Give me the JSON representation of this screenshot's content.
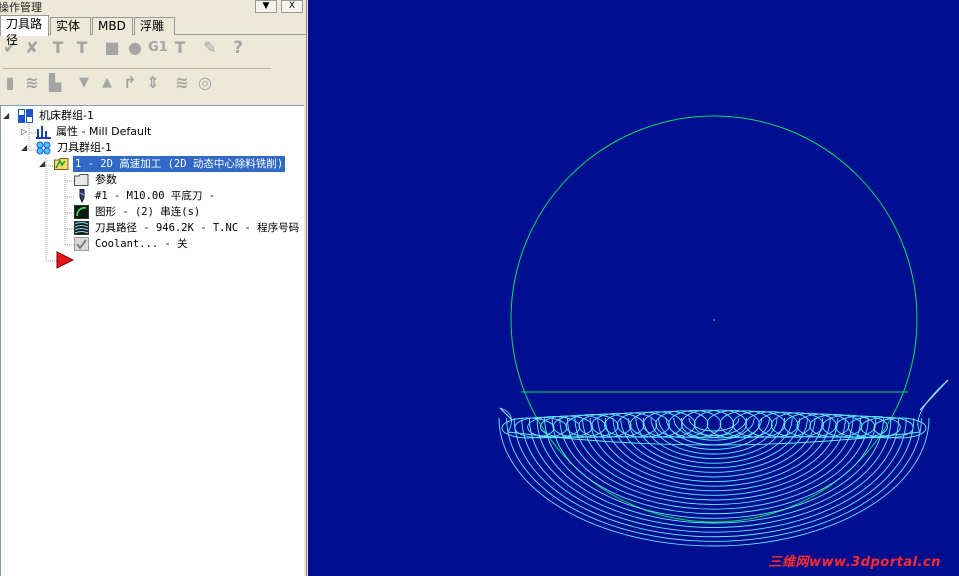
{
  "panel": {
    "title": "操作管理",
    "title_buttons": [
      "▼",
      "X"
    ]
  },
  "tabs": [
    {
      "label": "刀具路径",
      "active": true
    },
    {
      "label": "实体",
      "active": false
    },
    {
      "label": "MBD",
      "active": false
    },
    {
      "label": "浮雕",
      "active": false
    }
  ],
  "toolbar": {
    "row1_icons": [
      "select-all-ops-icon",
      "deselect-ops-icon",
      "regenerate-all-icon",
      "regenerate-dirty-icon",
      "backplot-icon",
      "verify-icon",
      "g1-post-icon",
      "toggle-display-icon",
      "high-feed-icon",
      "help-icon"
    ],
    "g1_label": "G1",
    "help_label": "?",
    "row2_icons": [
      "lock-icon",
      "toolpath-display-icon",
      "post-flag-icon",
      "move-down-icon",
      "move-up-icon",
      "insert-arrow-icon",
      "scroll-icon",
      "wave-icon",
      "visible-icon"
    ]
  },
  "tree": {
    "root": "机床群组-1",
    "properties": "属性 - Mill Default",
    "toolgroup": "刀具群组-1",
    "operation": "1 - 2D 高速加工 (2D 动态中心除料铣削)",
    "params": "参数",
    "tool": "#1 - M10.00 平底刀 -",
    "geometry": "图形 - (2) 串连(s)",
    "toolpath": "刀具路径 - 946.2K - T.NC - 程序号码",
    "coolant": "Coolant... - 关"
  },
  "viewport": {
    "background": "#000f8f",
    "geometry_color": "#00dd66",
    "toolpath_color": "#66e8ff",
    "watermark": "三维网www.3dportal.cn"
  }
}
